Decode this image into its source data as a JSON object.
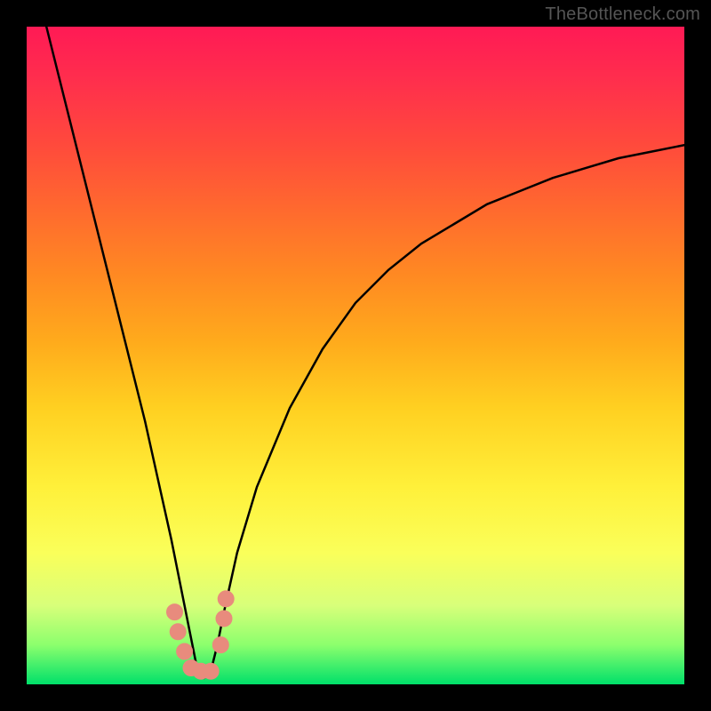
{
  "watermark": {
    "text": "TheBottleneck.com"
  },
  "chart_data": {
    "type": "line",
    "title": "",
    "xlabel": "",
    "ylabel": "",
    "xlim": [
      0,
      100
    ],
    "ylim": [
      0,
      100
    ],
    "grid": false,
    "legend": false,
    "description": "Bottleneck curve: V-shaped black curve on rainbow gradient; minimum near x≈26 at y≈0. Salmon markers cluster near the trough.",
    "series": [
      {
        "name": "bottleneck-curve",
        "x": [
          3,
          6,
          9,
          12,
          15,
          18,
          20,
          22,
          24,
          25,
          26,
          27,
          28,
          29,
          30,
          32,
          35,
          40,
          45,
          50,
          55,
          60,
          65,
          70,
          75,
          80,
          85,
          90,
          95,
          100
        ],
        "y": [
          100,
          88,
          76,
          64,
          52,
          40,
          31,
          22,
          12,
          7,
          2,
          1,
          2,
          6,
          11,
          20,
          30,
          42,
          51,
          58,
          63,
          67,
          70,
          73,
          75,
          77,
          78.5,
          80,
          81,
          82
        ]
      }
    ],
    "markers": [
      {
        "x": 22.5,
        "y": 11,
        "r": 9
      },
      {
        "x": 23.0,
        "y": 8,
        "r": 9
      },
      {
        "x": 24.0,
        "y": 5,
        "r": 9
      },
      {
        "x": 25.0,
        "y": 2.5,
        "r": 9
      },
      {
        "x": 26.5,
        "y": 2,
        "r": 9
      },
      {
        "x": 28.0,
        "y": 2,
        "r": 9
      },
      {
        "x": 29.5,
        "y": 6,
        "r": 9
      },
      {
        "x": 30.0,
        "y": 10,
        "r": 9
      },
      {
        "x": 30.3,
        "y": 13,
        "r": 9
      }
    ],
    "gradient_stops": [
      {
        "pos": 0,
        "color": "#ff1a55"
      },
      {
        "pos": 50,
        "color": "#ffab1c"
      },
      {
        "pos": 80,
        "color": "#faff5a"
      },
      {
        "pos": 100,
        "color": "#00e06a"
      }
    ]
  }
}
